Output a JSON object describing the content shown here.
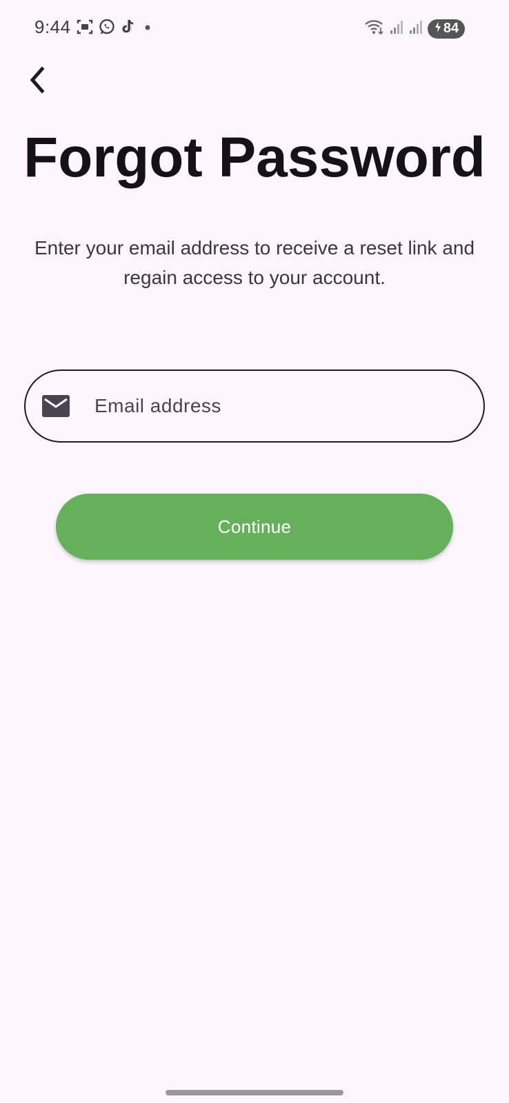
{
  "status_bar": {
    "time": "9:44",
    "battery_level": "84",
    "left_icons": [
      "screenshot-icon",
      "whatsapp-icon",
      "tiktok-icon",
      "notification-dot-icon"
    ],
    "right_icons": [
      "wifi-icon",
      "signal-icon",
      "signal-icon",
      "battery-charging-icon"
    ]
  },
  "header": {
    "back_icon": "chevron-left-icon"
  },
  "page": {
    "title": "Forgot Password",
    "subtitle_line1": "Enter your email address to receive a reset link and",
    "subtitle_line2": "regain access to your account."
  },
  "form": {
    "email_icon": "mail-icon",
    "email_placeholder": "Email address",
    "email_value": "",
    "submit_label": "Continue"
  },
  "colors": {
    "background": "#fdf7fd",
    "primary_button": "#66b05c",
    "text": "#141218"
  }
}
